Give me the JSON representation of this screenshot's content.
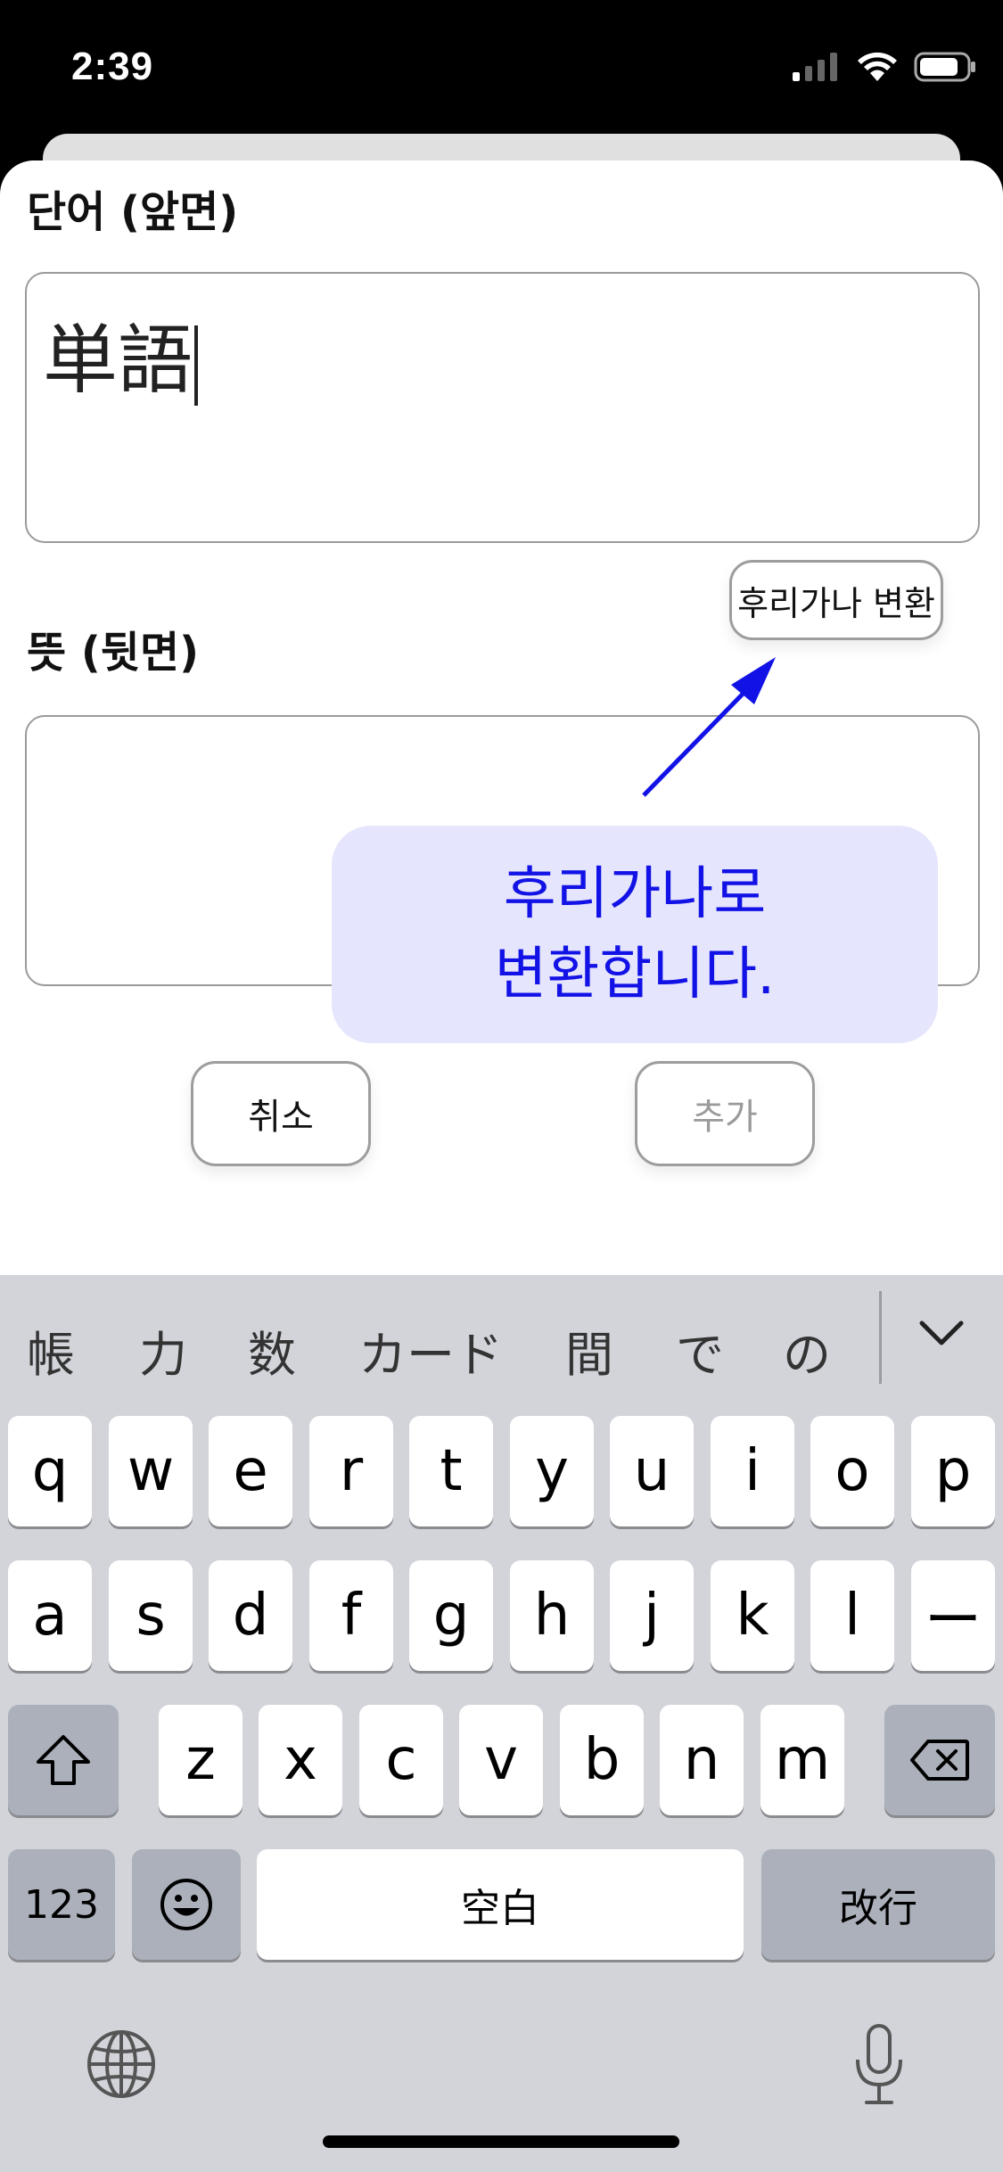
{
  "status": {
    "time": "2:39"
  },
  "form": {
    "front_label": "단어 (앞면)",
    "front_value": "単語",
    "furigana_button": "후리가나 변환",
    "back_label": "뜻 (뒷면)",
    "back_value": "",
    "cancel_button": "취소",
    "add_button": "추가"
  },
  "callout": {
    "line1": "후리가나로",
    "line2": "변환합니다."
  },
  "keyboard": {
    "suggestions": [
      "帳",
      "力",
      "数",
      "カード",
      "間",
      "で",
      "の"
    ],
    "row1": [
      "q",
      "w",
      "e",
      "r",
      "t",
      "y",
      "u",
      "i",
      "o",
      "p"
    ],
    "row2": [
      "a",
      "s",
      "d",
      "f",
      "g",
      "h",
      "j",
      "k",
      "l",
      "ー"
    ],
    "row3": [
      "z",
      "x",
      "c",
      "v",
      "b",
      "n",
      "m"
    ],
    "numbers_key": "123",
    "space_key": "空白",
    "return_key": "改行"
  },
  "colors": {
    "callout_bg": "#e5e5fd",
    "callout_text": "#1212e6",
    "keyboard_bg": "#d2d4da"
  }
}
